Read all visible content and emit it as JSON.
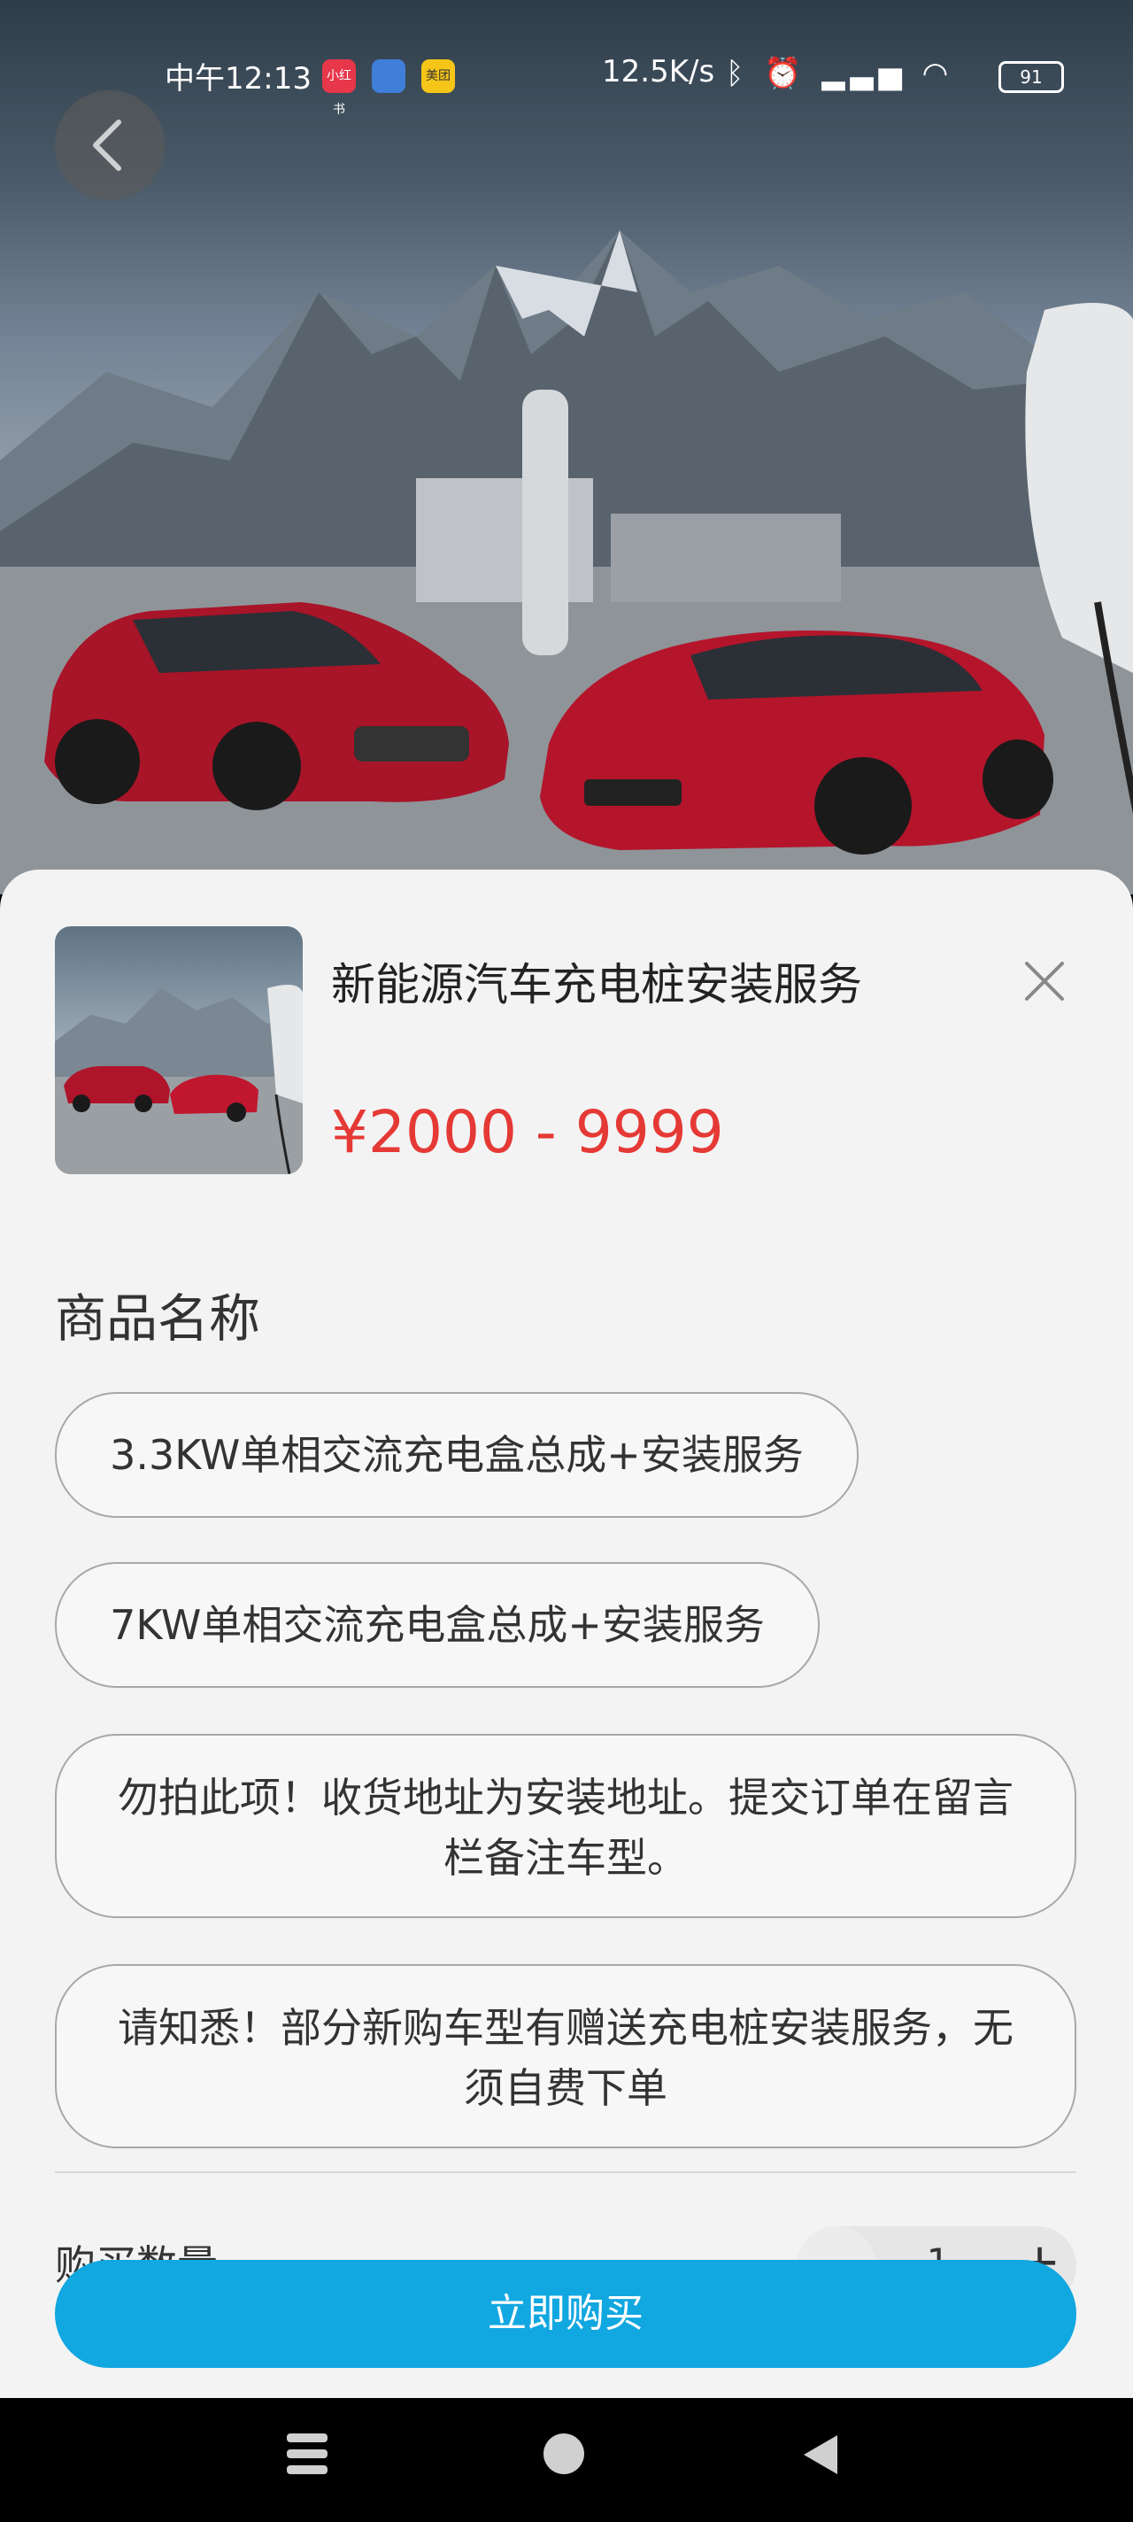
{
  "status_bar": {
    "time": "中午12:13",
    "apps": [
      {
        "name": "xiaohongshu",
        "label": "小红书",
        "color": "#e8364a"
      },
      {
        "name": "notes",
        "label": "",
        "color": "#3f7fd9"
      },
      {
        "name": "meituan",
        "label": "美团",
        "color": "#f5c518"
      }
    ],
    "network_speed": "12.5K/s",
    "battery": "91"
  },
  "product": {
    "title": "新能源汽车充电桩安装服务",
    "price": "¥2000 - 9999"
  },
  "spec_section": {
    "label": "商品名称",
    "options": [
      "3.3KW单相交流充电盒总成+安装服务",
      "7KW单相交流充电盒总成+安装服务",
      "勿拍此项！收货地址为安装地址。提交订单在留言栏备注车型。",
      "请知悉！部分新购车型有赠送充电桩安装服务，无须自费下单"
    ]
  },
  "quantity": {
    "label": "购买数量",
    "value": "1"
  },
  "buy_button": "立即购买",
  "colors": {
    "accent": "#11a7e0",
    "price": "#e53935",
    "car_red": "#b0142a"
  }
}
